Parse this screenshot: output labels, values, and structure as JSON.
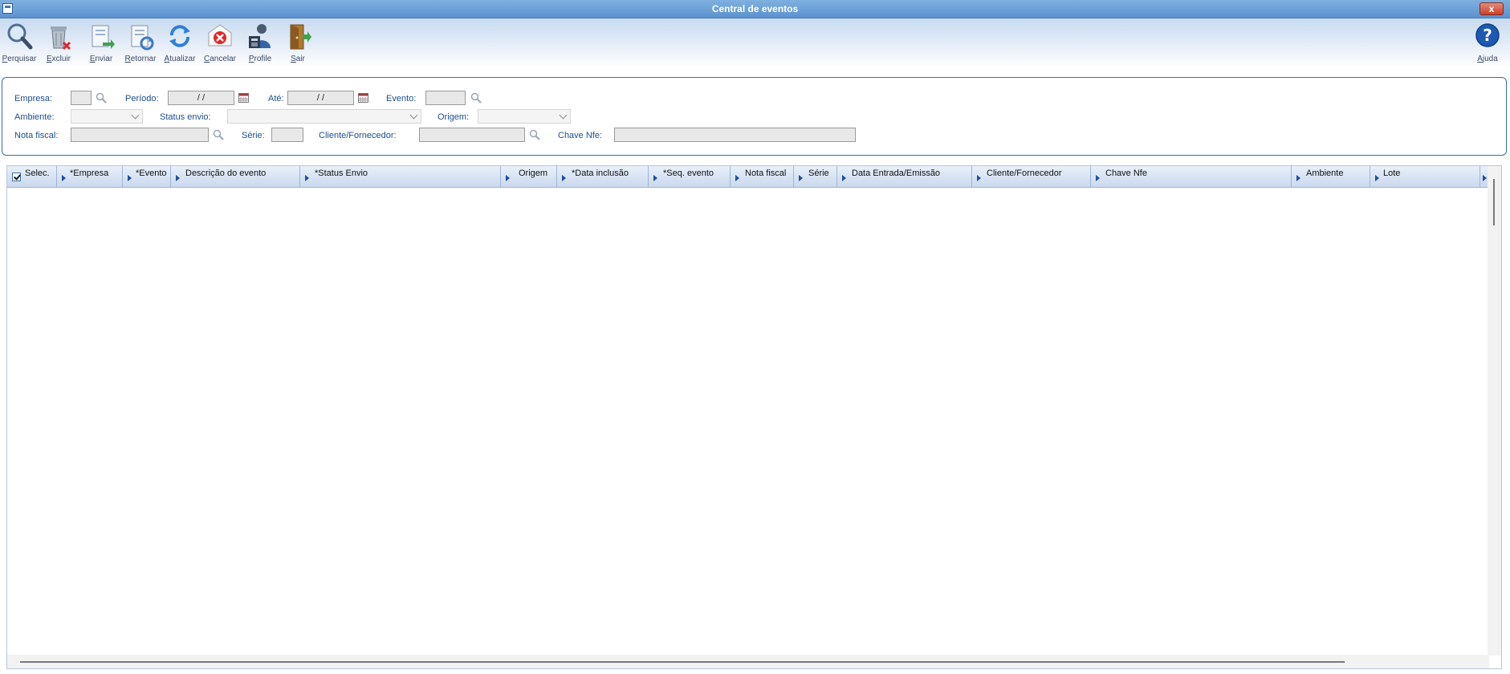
{
  "window": {
    "title": "Central de eventos",
    "close_label": "x"
  },
  "toolbar": {
    "buttons": [
      {
        "label": "Perquisar",
        "icon": "search-magnifier-icon"
      },
      {
        "label": "Excluir",
        "icon": "trash-can-icon"
      },
      {
        "label": "Enviar",
        "icon": "send-document-icon"
      },
      {
        "label": "Retornar",
        "icon": "return-document-icon"
      },
      {
        "label": "Atualizar",
        "icon": "refresh-icon"
      },
      {
        "label": "Cancelar",
        "icon": "cancel-icon"
      },
      {
        "label": "Profile",
        "icon": "profile-user-icon"
      },
      {
        "label": "Sair",
        "icon": "exit-door-icon"
      }
    ],
    "help": {
      "label": "Ajuda",
      "icon": "help-icon",
      "glyph": "?"
    }
  },
  "filters": {
    "empresa": {
      "label": "Empresa:",
      "value": ""
    },
    "periodo": {
      "label": "Período:",
      "value": " / /"
    },
    "ate": {
      "label": "Até:",
      "value": " / /"
    },
    "evento": {
      "label": "Evento:",
      "value": ""
    },
    "ambiente": {
      "label": "Ambiente:",
      "value": ""
    },
    "status_envio": {
      "label": "Status envio:",
      "value": ""
    },
    "origem": {
      "label": "Origem:",
      "value": ""
    },
    "nota_fiscal": {
      "label": "Nota fiscal:",
      "value": ""
    },
    "serie": {
      "label": "Série:",
      "value": ""
    },
    "cliente_fornecedor": {
      "label": "Cliente/Fornecedor:",
      "value": ""
    },
    "chave_nfe": {
      "label": "Chave Nfe:",
      "value": ""
    }
  },
  "grid": {
    "columns": [
      "Selec.",
      "*Empresa",
      "*Evento",
      "Descrição do evento",
      "*Status Envio",
      "Origem",
      "*Data inclusão",
      "*Seq. evento",
      "Nota fiscal",
      "Série",
      "Data Entrada/Emissão",
      "Cliente/Fornecedor",
      "Chave Nfe",
      "Ambiente",
      "Lote"
    ],
    "select_all_checked": true,
    "rows": []
  },
  "colors": {
    "accent": "#2f6fb3",
    "label": "#1e4e8c",
    "title_bar": "#5b92cf"
  }
}
